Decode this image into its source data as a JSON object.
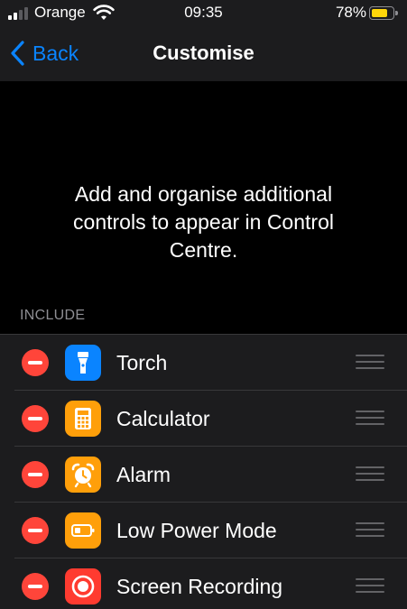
{
  "status_bar": {
    "carrier": "Orange",
    "time": "09:35",
    "battery_percent": "78%",
    "battery_level": 0.78,
    "signal_bars_active": 2,
    "signal_bars_total": 4
  },
  "nav": {
    "back_label": "Back",
    "title": "Customise"
  },
  "description": "Add and organise additional controls to appear in Control Centre.",
  "section": {
    "header": "INCLUDE"
  },
  "controls": [
    {
      "label": "Torch",
      "icon": "torch-icon",
      "color": "#0a84ff"
    },
    {
      "label": "Calculator",
      "icon": "calculator-icon",
      "color": "#ff9f0a"
    },
    {
      "label": "Alarm",
      "icon": "alarm-icon",
      "color": "#ff9f0a"
    },
    {
      "label": "Low Power Mode",
      "icon": "battery-icon",
      "color": "#ff9f0a"
    },
    {
      "label": "Screen Recording",
      "icon": "record-icon",
      "color": "#ff3b30"
    }
  ],
  "colors": {
    "accent": "#0a84ff",
    "remove": "#ff453a",
    "battery_fill": "#ffd60a",
    "separator": "#38383a",
    "secondary_text": "#8e8e93"
  }
}
